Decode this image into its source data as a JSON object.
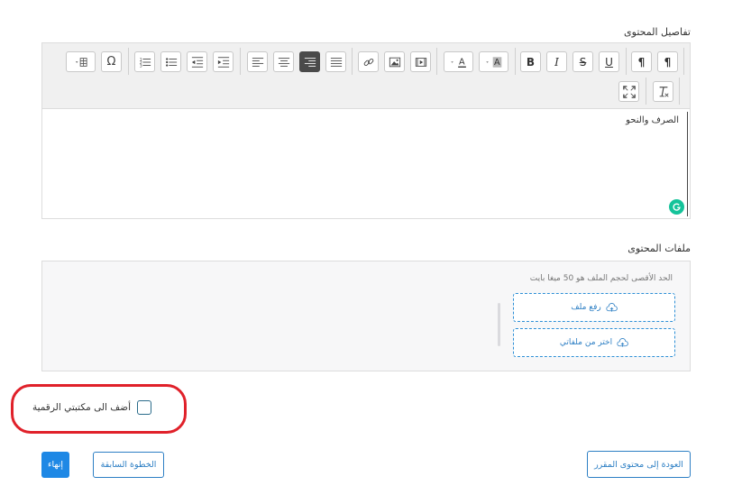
{
  "content_details": {
    "label": "تفاصيل المحتوى",
    "editor_text": "الصرف والنحو",
    "toolbar_icons": [
      "table-icon",
      "omega-icon",
      "numbered-list-icon",
      "bulleted-list-icon",
      "outdent-icon",
      "indent-icon",
      "align-left-icon",
      "align-center-icon",
      "align-right-icon",
      "justify-icon",
      "link-icon",
      "image-icon",
      "media-icon",
      "text-color-icon",
      "background-color-icon",
      "bold-icon",
      "italic-icon",
      "strikethrough-icon",
      "underline-icon",
      "ltr-icon",
      "rtl-icon",
      "maximize-icon",
      "remove-format-icon"
    ],
    "text_color_glyph": "A",
    "bg_color_glyph": "A",
    "bold_glyph": "B",
    "italic_glyph": "I",
    "strike_glyph": "S",
    "underline_glyph": "U",
    "omega_glyph": "Ω",
    "ltr_glyph": "¶",
    "rtl_glyph": "¶",
    "accent": "#4a4a4a"
  },
  "content_files": {
    "label": "ملفات المحتوى",
    "max_size_note": "الحد الأقصى لحجم الملف هو 50 ميغا بايت",
    "upload_file": "رفع ملف",
    "choose_from_files": "اختر من ملفاتي"
  },
  "add_to_library": {
    "label": "أضف الى مكتبتي الرقمية",
    "checked": false,
    "highlight_color": "#e0212a"
  },
  "footer": {
    "finish": "إنهاء",
    "previous_step": "الخطوة السابقة",
    "back_to_course": "العودة إلى محتوى المقرر"
  },
  "colors": {
    "primary": "#1e88e5",
    "link": "#2d7fc4"
  }
}
